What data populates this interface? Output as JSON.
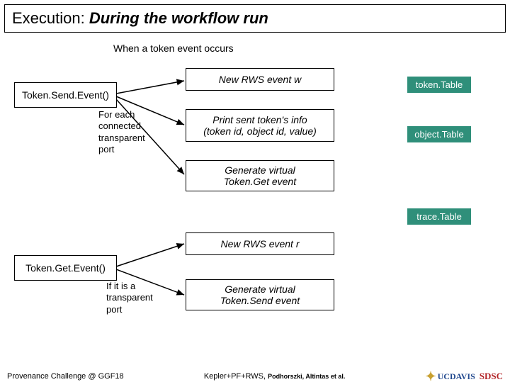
{
  "title": {
    "plain": "Execution: ",
    "emph": "During the workflow run"
  },
  "subtitle": "When a token event occurs",
  "boxes": {
    "tokenSend": "Token.Send.Event()",
    "tokenGet": "Token.Get.Event()",
    "newW": "New RWS event w",
    "printInfo": "Print sent token's info\n(token id, object id, value)",
    "genGet": "Generate virtual\nToken.Get event",
    "newR": "New RWS event r",
    "genSend": "Generate virtual\nToken.Send event"
  },
  "captions": {
    "forEach": "For each\nconnected\ntransparent\nport",
    "ifTrans": "If it is a\ntransparent\nport"
  },
  "tables": {
    "token": "token.Table",
    "object": "object.Table",
    "trace": "trace.Table"
  },
  "footer": {
    "left": "Provenance Challenge @ GGF18",
    "citeMain": "Kepler+PF+RWS,",
    "citeSub": "Podhorszki, Altintas et al.",
    "ucd": "UCDAVIS",
    "sdsc": "SDSC"
  }
}
